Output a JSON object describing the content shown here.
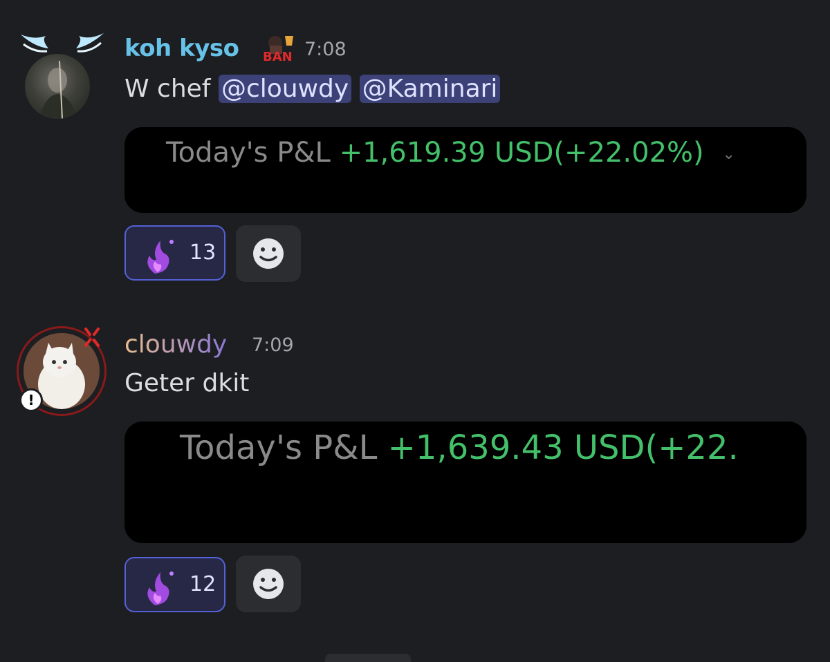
{
  "messages": [
    {
      "username": "koh kyso",
      "badge_text": "BAN",
      "time": "7:08",
      "text_prefix": "W chef",
      "mentions": [
        "@clouwdy",
        "@Kaminari"
      ],
      "embed": {
        "label": "Today's P&L",
        "value": "+1,619.39 USD(+22.02%)"
      },
      "reaction": {
        "icon": "purple-flame-emoji",
        "count": "13"
      },
      "colors": {
        "username": "#67c2e8"
      }
    },
    {
      "username": "clouwdy",
      "time": "7:09",
      "text": "Geter dkit",
      "embed": {
        "label": "Today's P&L",
        "value": "+1,639.43 USD(+22."
      },
      "reaction": {
        "icon": "purple-flame-emoji",
        "count": "12"
      },
      "colors": {
        "username_from": "#e9bd8f",
        "username_to": "#8b78d8"
      }
    }
  ],
  "colors": {
    "background": "#1d1e22",
    "embed_bg": "#000000",
    "pnl_green": "#44c06a",
    "reaction_border": "#5561d6",
    "mention_bg": "#3c4177"
  },
  "icons": [
    "wing-icon",
    "ban-badge-icon",
    "smiley-add-reaction-icon",
    "anger-icon",
    "alert-status-icon",
    "chevron-down-icon"
  ]
}
